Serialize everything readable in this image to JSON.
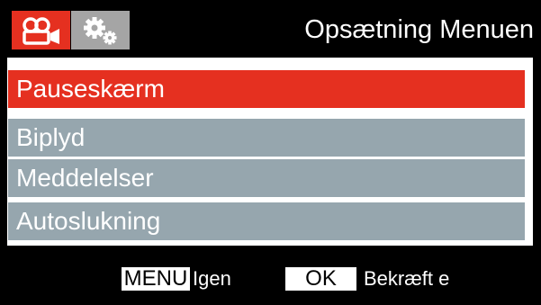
{
  "header": {
    "title": "Opsætning Menuen",
    "tabs": [
      {
        "icon": "video-camera-icon",
        "active": true
      },
      {
        "icon": "settings-gears-icon",
        "active": false
      }
    ]
  },
  "menu": {
    "items": [
      {
        "label": "Pauseskærm",
        "selected": true
      },
      {
        "label": "Biplyd",
        "selected": false
      },
      {
        "label": "Meddelelser",
        "selected": false
      },
      {
        "label": "Autoslukning",
        "selected": false
      }
    ]
  },
  "footer": {
    "menu_key": "MENU",
    "menu_action": "Igen",
    "ok_key": "OK",
    "ok_action": "Bekræft e"
  },
  "colors": {
    "accent": "#e53020",
    "item_background": "#96a6ae",
    "inactive_tab": "#a5a5a5",
    "frame": "#000000"
  }
}
